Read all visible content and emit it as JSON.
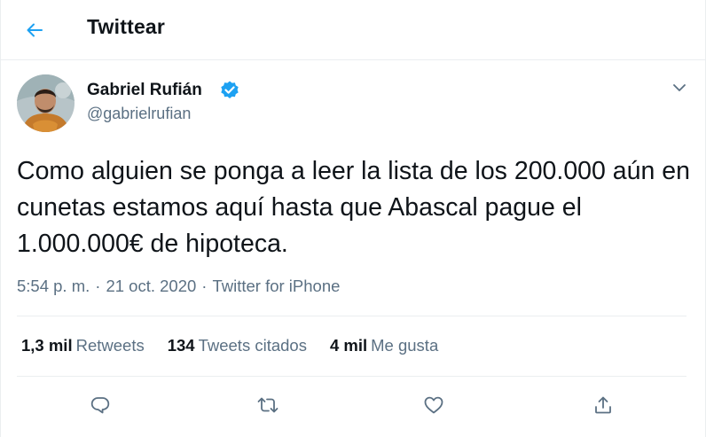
{
  "header": {
    "title": "Twittear",
    "back_icon": "arrow-left-icon"
  },
  "tweet": {
    "author_name": "Gabriel Rufián",
    "handle": "@gabrielrufian",
    "verified": true,
    "text": "Como alguien se ponga a leer la lista de los 200.000 aún en cunetas estamos aquí hasta que Abascal pague el 1.000.000€ de hipoteca.",
    "time": "5:54 p. m.",
    "date": "21 oct. 2020",
    "separator": "·",
    "source": "Twitter for iPhone"
  },
  "stats": {
    "retweets": {
      "count": "1,3 mil",
      "label": "Retweets"
    },
    "quotes": {
      "count": "134",
      "label": "Tweets citados"
    },
    "likes": {
      "count": "4 mil",
      "label": "Me gusta"
    }
  },
  "actions": [
    "reply-icon",
    "retweet-icon",
    "like-icon",
    "share-icon"
  ],
  "colors": {
    "accent": "#1da1f2",
    "secondary_text": "#5b7083",
    "primary_text": "#0f1419",
    "border": "#ebeef0"
  }
}
